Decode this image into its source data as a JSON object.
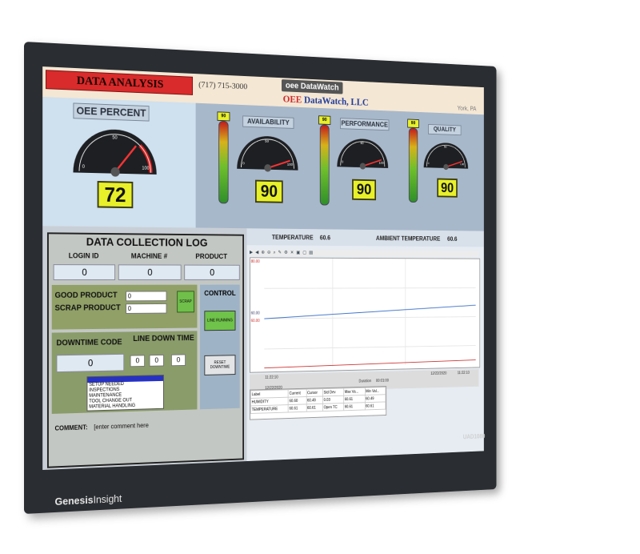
{
  "header": {
    "title": "DATA ANALYSIS",
    "phone": "(717) 715-3000",
    "logo_text": "oee DataWatch",
    "company_red": "OEE",
    "company_blue": "DataWatch, LLC",
    "location": "York, PA"
  },
  "oee": {
    "label": "OEE PERCENT",
    "value": "72",
    "level": 0.72,
    "ticks": [
      "0",
      "50",
      "100"
    ]
  },
  "gauges": [
    {
      "label": "AVAILABILITY",
      "value": "90",
      "level": 0.9,
      "thermo_top": "90",
      "ticks": [
        "0",
        "50",
        "100"
      ]
    },
    {
      "label": "PERFORMANCE",
      "value": "90",
      "level": 0.9,
      "thermo_top": "90",
      "ticks": [
        "0",
        "50",
        "100"
      ]
    },
    {
      "label": "QUALITY",
      "value": "90",
      "level": 0.9,
      "thermo_top": "90",
      "ticks": [
        "0",
        "50",
        "100"
      ]
    }
  ],
  "log": {
    "title": "DATA COLLECTION LOG",
    "login_label": "LOGIN ID",
    "login_value": "0",
    "machine_label": "MACHINE #",
    "machine_value": "0",
    "product_label": "PRODUCT",
    "product_value": "0",
    "good_label": "GOOD PRODUCT",
    "good_value": "0",
    "scrap_label": "SCRAP PRODUCT",
    "scrap_value": "0",
    "scrap_button": "SCRAP",
    "downtime_label": "DOWNTIME CODE",
    "downtime_value": "0",
    "linedown_label": "LINE DOWN TIME",
    "linedown_h": "0",
    "linedown_m": "0",
    "linedown_s": "0",
    "reasons": [
      "",
      "SETUP NEEDED",
      "INSPECTIONS",
      "MAINTENANCE",
      "TOOL CHANGE OUT",
      "MATERIAL HANDLING"
    ],
    "control_label": "CONTROL",
    "line_button": "LINE RUNNING",
    "reset_button": "RESET DOWNTIME",
    "comment_label": "COMMENT:",
    "comment_value": "[enter comment here"
  },
  "sensors": {
    "temperature_label": "TEMPERATURE",
    "temperature_value": "60.6",
    "ambient_label": "AMBIENT TEMPERATURE",
    "ambient_value": "60.6"
  },
  "trend": {
    "ylabels": [
      "80.00",
      "60.00",
      "60.00"
    ],
    "start_date": "12/22/2020",
    "start_time": "11:22:10",
    "end_date": "12/22/2020",
    "end_time": "11:22:10",
    "duration_label": "Duration",
    "duration_value": "00:01:00",
    "colors": {
      "humidity": "#3b6fc7",
      "temperature": "#d04040"
    },
    "table_headers": [
      "Label",
      "Current",
      "Cursor",
      "Std Dev",
      "Max Va...",
      "Min Val..."
    ],
    "rows": [
      [
        "HUMIDITY",
        "60.60",
        "60.49",
        "0.03",
        "60.61",
        "60.49"
      ],
      [
        "TEMPERATURE",
        "60.61",
        "60.61",
        "Open TC",
        "60.61",
        "60.61"
      ]
    ]
  },
  "bezel": {
    "brand_a": "Genesis",
    "brand_b": "Insight",
    "model": "UAD1080"
  }
}
